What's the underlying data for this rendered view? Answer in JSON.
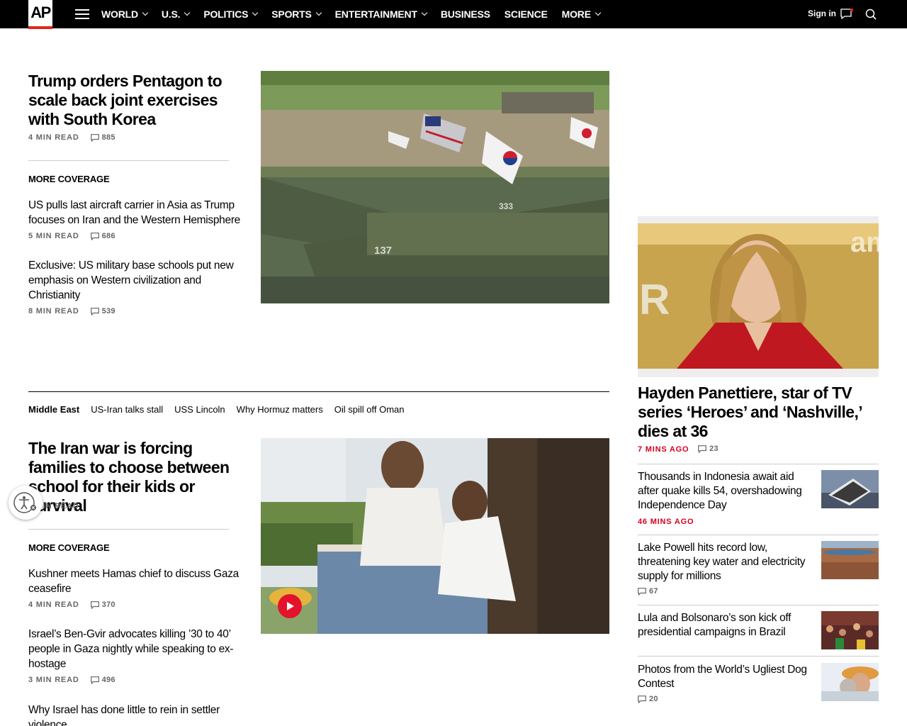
{
  "nav": {
    "logo": "AP",
    "links": [
      {
        "label": "WORLD",
        "dropdown": true
      },
      {
        "label": "U.S.",
        "dropdown": true
      },
      {
        "label": "POLITICS",
        "dropdown": true
      },
      {
        "label": "SPORTS",
        "dropdown": true
      },
      {
        "label": "ENTERTAINMENT",
        "dropdown": true
      },
      {
        "label": "BUSINESS",
        "dropdown": false
      },
      {
        "label": "SCIENCE",
        "dropdown": false
      },
      {
        "label": "MORE",
        "dropdown": true
      }
    ],
    "signin": "Sign in",
    "accent": "#e2231a"
  },
  "lead1": {
    "headline": "Trump orders Pentagon to scale back joint exercises with South Korea",
    "read": "4 MIN READ",
    "comments": "885",
    "more_coverage": "MORE COVERAGE",
    "items": [
      {
        "headline": "US pulls last aircraft carrier in Asia as Trump focuses on Iran and the Western Hemisphere",
        "read": "5 MIN READ",
        "comments": "686"
      },
      {
        "headline": "Exclusive: US military base schools put new emphasis on Western civilization and Christianity",
        "read": "8 MIN READ",
        "comments": "539"
      }
    ]
  },
  "tags": [
    "Middle East",
    "US-Iran talks stall",
    "USS Lincoln",
    "Why Hormuz matters",
    "Oil spill off Oman"
  ],
  "lead2": {
    "headline": "The Iran war is forcing families to choose between school for their kids or survival",
    "read": "7 MIN READ",
    "more_coverage": "MORE COVERAGE",
    "items": [
      {
        "headline": "Kushner meets Hamas chief to discuss Gaza ceasefire",
        "read": "4 MIN READ",
        "comments": "370"
      },
      {
        "headline": "Israel’s Ben-Gvir advocates killing ’30 to 40’ people in Gaza nightly while speaking to ex-hostage",
        "read": "3 MIN READ",
        "comments": "496"
      },
      {
        "headline": "Why Israel has done little to rein in settler violence",
        "read": "",
        "comments": ""
      }
    ]
  },
  "sidebar": {
    "top": {
      "headline": "Hayden Panettiere, star of TV series ‘Heroes’ and ‘Nashville,’ dies at 36",
      "time": "7 MINS AGO",
      "comments": "23"
    },
    "items": [
      {
        "headline": "Thousands in Indonesia await aid after quake kills 54, overshadowing Independence Day",
        "time": "46 MINS AGO",
        "comments": ""
      },
      {
        "headline": "Lake Powell hits record low, threatening key water and electricity supply for millions",
        "time": "",
        "comments": "67"
      },
      {
        "headline": "Lula and Bolsonaro’s son kick off presidential campaigns in Brazil",
        "time": "",
        "comments": ""
      },
      {
        "headline": "Photos from the World’s Ugliest Dog Contest",
        "time": "",
        "comments": "20"
      }
    ]
  }
}
